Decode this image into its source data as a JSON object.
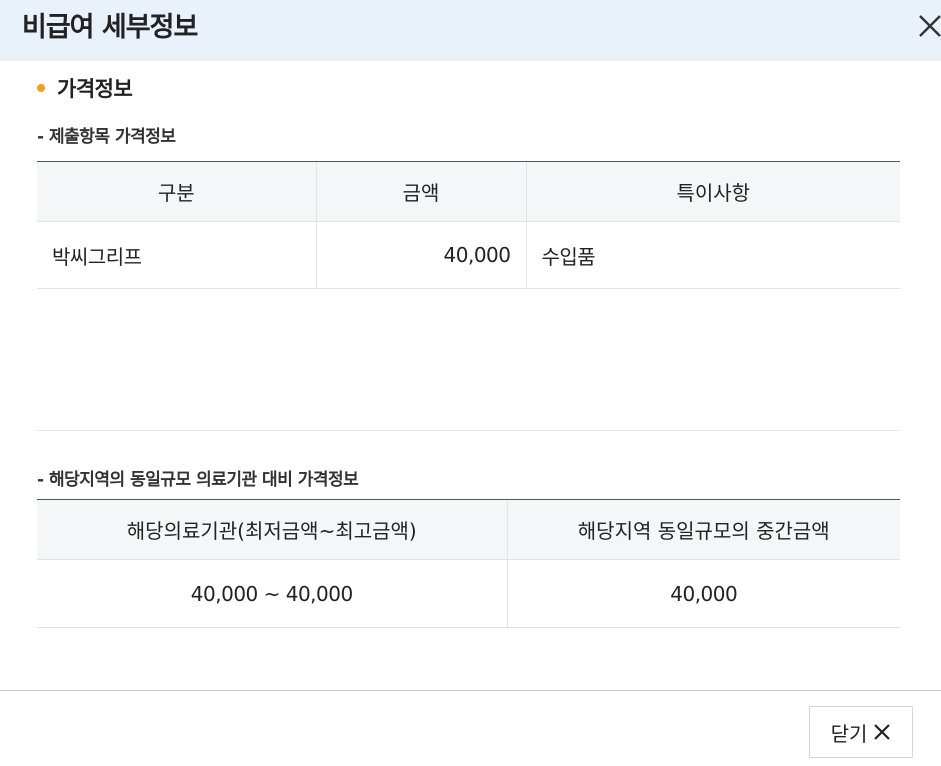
{
  "dialog": {
    "title": "비급여 세부정보"
  },
  "section": {
    "title": "가격정보"
  },
  "submitted": {
    "subtitle": "- 제출항목 가격정보",
    "headers": [
      "구분",
      "금액",
      "특이사항"
    ],
    "rows": [
      [
        "박씨그리프",
        "40,000",
        "수입품"
      ]
    ]
  },
  "regional": {
    "subtitle": "- 해당지역의 동일규모 의료기관 대비 가격정보",
    "headers": [
      "해당의료기관(최저금액~최고금액)",
      "해당지역 동일규모의 중간금액"
    ],
    "rows": [
      [
        "40,000 ~ 40,000",
        "40,000"
      ]
    ]
  },
  "footer": {
    "close_label": "닫기"
  },
  "icons": {
    "header_close": "close-icon",
    "button_close": "close-icon"
  },
  "colors": {
    "header_bg": "#e9f1fb",
    "bullet": "#f5a01a"
  }
}
